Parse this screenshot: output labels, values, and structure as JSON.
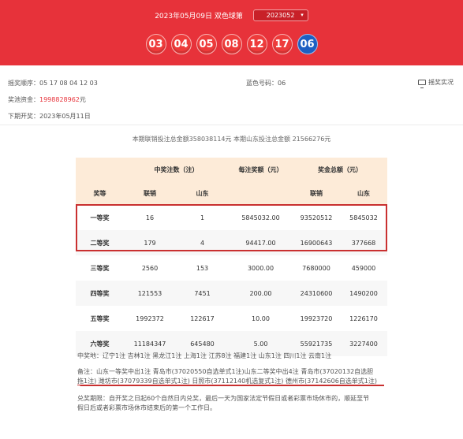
{
  "header": {
    "draw_date": "2023年05月09日",
    "lottery_name": "双色球第",
    "issue_select": "2023052"
  },
  "balls": {
    "red": [
      "03",
      "04",
      "05",
      "08",
      "12",
      "17"
    ],
    "blue": "06"
  },
  "info": {
    "order_label": "摇奖顺序：",
    "order_value": "05 17 08 04 12 03",
    "blue_label": "蓝色号码：",
    "blue_value": "06",
    "report_label": "摇奖实况",
    "pool_label": "奖池资金：",
    "pool_value": "1998828962",
    "pool_unit": "元",
    "deadline_label": "下期开奖：",
    "deadline_value": "2023年05月11日"
  },
  "sales": {
    "text": "本期联销投注总金额358038114元 本期山东投注总金额 21566276元"
  },
  "table": {
    "header1": [
      "中奖注数（注）",
      "每注奖额（元）",
      "奖金总额（元）"
    ],
    "header2": [
      "奖等",
      "联销",
      "山东",
      "",
      "联销",
      "山东"
    ],
    "rows": [
      {
        "level": "一等奖",
        "u": "16",
        "sd": "1",
        "per": "5845032.00",
        "tu": "93520512",
        "tsd": "5845032"
      },
      {
        "level": "二等奖",
        "u": "179",
        "sd": "4",
        "per": "94417.00",
        "tu": "16900643",
        "tsd": "377668"
      },
      {
        "level": "三等奖",
        "u": "2560",
        "sd": "153",
        "per": "3000.00",
        "tu": "7680000",
        "tsd": "459000"
      },
      {
        "level": "四等奖",
        "u": "121553",
        "sd": "7451",
        "per": "200.00",
        "tu": "24310600",
        "tsd": "1490200"
      },
      {
        "level": "五等奖",
        "u": "1992372",
        "sd": "122617",
        "per": "10.00",
        "tu": "19923720",
        "tsd": "1226170"
      },
      {
        "level": "六等奖",
        "u": "11184347",
        "sd": "645480",
        "per": "5.00",
        "tu": "55921735",
        "tsd": "3227400"
      }
    ]
  },
  "notes": {
    "winners": "中奖地：辽宁1注 吉林1注 黑龙江1注 上海1注 江苏8注 福建1注 山东1注 四川1注 云南1注",
    "remark_label": "备注：",
    "remark_line1": "山东一等奖中出1注 青岛市(37020550自选单式1注)山东二等奖中出4注 青岛市(37020132自选胆",
    "remark_line2a": "拖1注)",
    "remark_line2b": " 潍坊市(37079339自选单式1注) 日照市(37112140机选复式1注) 德州市(37142606自选单式1注)",
    "claim_line1": "兑奖期限：自开奖之日起60个自然日内兑奖，最后一天为国家法定节假日或者彩票市场休市的，顺延至节",
    "claim_line2": "假日后或者彩票市场休市结束后的第一个工作日。"
  }
}
